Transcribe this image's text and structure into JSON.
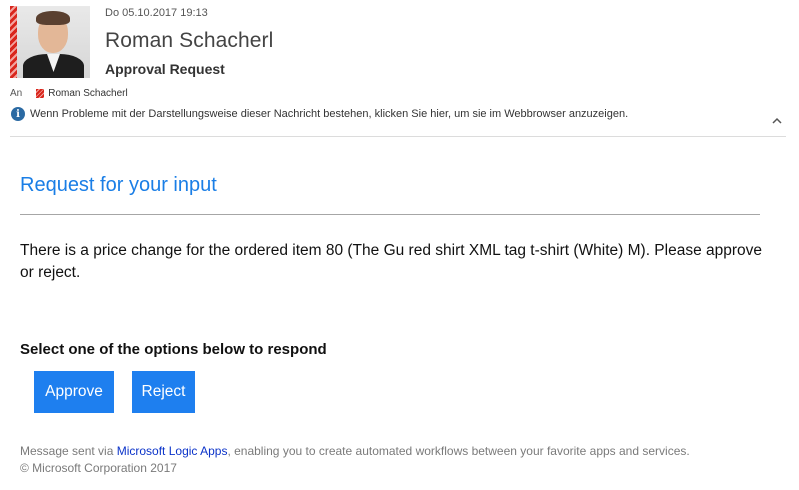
{
  "header": {
    "date": "Do 05.10.2017 19:13",
    "sender": "Roman Schacherl",
    "subject": "Approval Request",
    "to_label": "An",
    "recipient": "Roman Schacherl",
    "info_text": "Wenn Probleme mit der Darstellungsweise dieser Nachricht bestehen, klicken Sie hier, um sie im Webbrowser anzuzeigen.",
    "info_icon": "info-icon",
    "presence_color": "#d9261c"
  },
  "message": {
    "title": "Request for your input",
    "body": "There is a price change for the ordered item 80 (The Gu red shirt XML tag t-shirt (White) M). Please approve or reject.",
    "prompt": "Select one of the options below to respond",
    "approve_label": "Approve",
    "reject_label": "Reject",
    "button_color": "#1e7fef",
    "title_color": "#1a7ee6"
  },
  "footer": {
    "prefix": "Message sent via ",
    "link": "Microsoft Logic Apps",
    "suffix": ", enabling you to create automated workflows between your favorite apps and services.",
    "copyright": "© Microsoft Corporation 2017"
  }
}
